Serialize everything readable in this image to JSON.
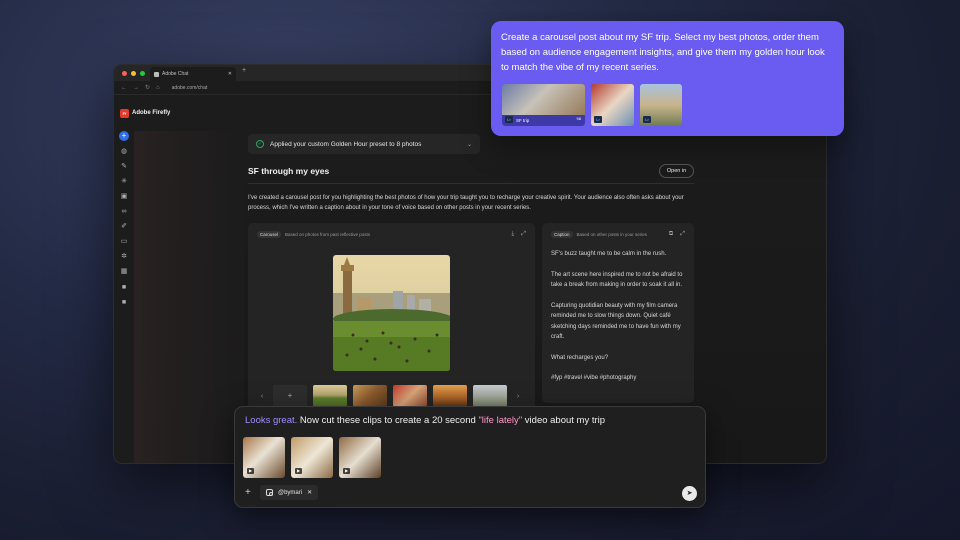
{
  "browser": {
    "tab_title": "Adobe Chat",
    "url": "adobe.com/chat",
    "close_glyph": "✕",
    "newtab_glyph": "+",
    "traffic_lights": [
      "#ff5f57",
      "#febc2e",
      "#28c840"
    ]
  },
  "app": {
    "brand_logo": "Ff",
    "brand_name": "Adobe Firefly",
    "sidebar_icons": [
      "add-icon",
      "chat-icon",
      "edit-icon",
      "sparkle-icon",
      "image-icon",
      "link-icon",
      "brush-icon",
      "folder-icon",
      "settings-icon",
      "grid-icon",
      "photoshop-icon",
      "app-icon"
    ]
  },
  "status": {
    "preset_message": "Applied your custom Golden Hour preset to 8 photos"
  },
  "main": {
    "title": "SF through my eyes",
    "open_button": "Open in",
    "description": "I've created a carousel post for you highlighting the best photos of how your trip taught you to recharge your creative spirit. Your audience also often asks about your process, which I've written a caption about in your tone of voice based on other posts in your recent series."
  },
  "carousel": {
    "chip": "Carousel",
    "subtitle": "Based on photos from past reflective posts"
  },
  "caption": {
    "chip": "Caption",
    "subtitle": "Based on other posts in your series",
    "paragraphs": [
      "SF's buzz taught me to be calm in the rush.",
      "The art scene here inspired me to not be afraid to take a break from making in order to soak it all in.",
      "Capturing quotidian beauty with my film camera reminded me to slow things down. Quiet café sketching days reminded me to have fun with my craft.",
      "What recharges you?",
      "#fyp #travel #vibe #photography"
    ]
  },
  "prompt_bubble": {
    "text": "Create a carousel post about my SF trip. Select my best photos, order them based on audience engagement insights, and give them my golden hour look to match the vibe of my recent series.",
    "album_label": "SF trip",
    "album_count": "98",
    "badge": "Lr"
  },
  "chat_input": {
    "part1": "Looks great.",
    "part2": " Now cut these clips to create a 20 second ",
    "part3": "\"life lately\"",
    "part4": " video about my trip",
    "handle": "@bymari",
    "chip_close": "✕",
    "add_glyph": "+",
    "send_glyph": "➤"
  },
  "colors": {
    "accent_blue": "#2f6ee8",
    "bubble_purple": "#6a5cf0",
    "success_green": "#31a66a",
    "highlight_purple": "#9f8cff",
    "highlight_pink": "#ff9ac8"
  }
}
